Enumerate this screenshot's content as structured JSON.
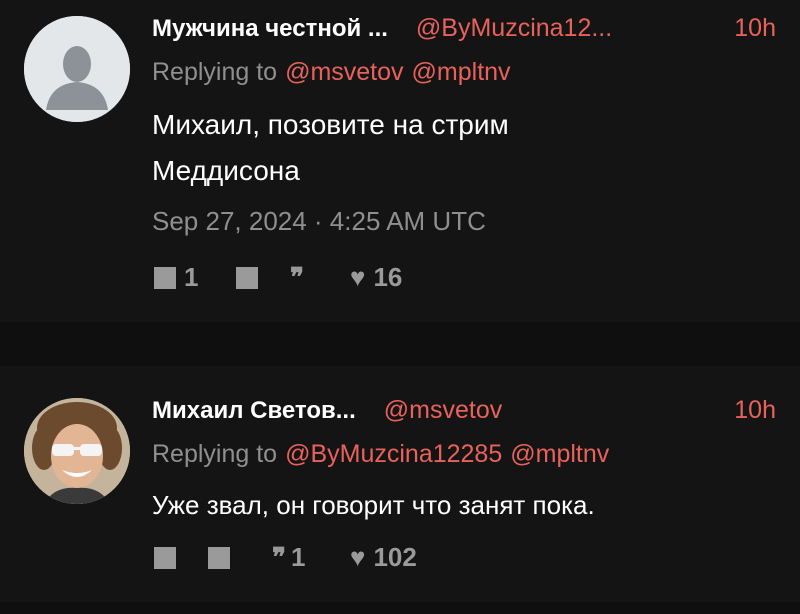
{
  "tweets": [
    {
      "name": "Мужчина честной ...",
      "handle": "@ByMuzcina12...",
      "time": "10h",
      "replying_prefix": "Replying to",
      "replying_to": [
        "@msvetov",
        "@mpltnv"
      ],
      "text_lines": [
        "Михаил, позовите на стрим",
        "Меддисона"
      ],
      "date": "Sep 27, 2024 · 4:25 AM UTC",
      "stats": {
        "comments": "1",
        "retweets": "",
        "quotes": "",
        "likes": "16"
      }
    },
    {
      "name": "Михаил Светов...",
      "handle": "@msvetov",
      "time": "10h",
      "replying_prefix": "Replying to",
      "replying_to": [
        "@ByMuzcina12285",
        "@mpltnv"
      ],
      "text_lines": [
        "Уже звал, он говорит что занят пока."
      ],
      "stats": {
        "comments": "",
        "retweets": "",
        "quotes": "1",
        "likes": "102"
      }
    }
  ],
  "icons": {
    "comment": "square-icon",
    "retweet": "square-icon",
    "quote": "quote-icon",
    "like": "heart-icon"
  },
  "colors": {
    "background": "#0f0f0f",
    "card": "#141414",
    "accent": "#e8625c",
    "muted": "#8f8f8f"
  }
}
